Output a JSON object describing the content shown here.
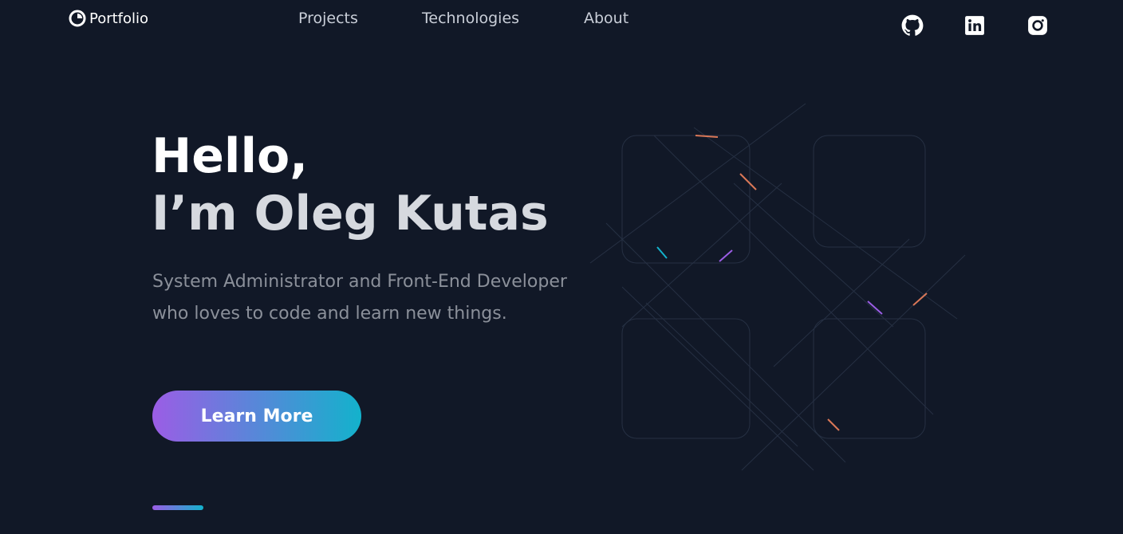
{
  "header": {
    "logo_text": "Portfolio",
    "nav": [
      "Projects",
      "Technologies",
      "About"
    ],
    "social": [
      "github-icon",
      "linkedin-icon",
      "instagram-icon"
    ]
  },
  "hero": {
    "line1": "Hello,",
    "line2": "I’m Oleg Kutas",
    "subtitle": "System Administrator and Front-End Developer who loves to code and learn new things.",
    "cta_label": "Learn More"
  },
  "colors": {
    "background": "#111827",
    "accent_start": "#9b5de5",
    "accent_end": "#13b2cc"
  }
}
